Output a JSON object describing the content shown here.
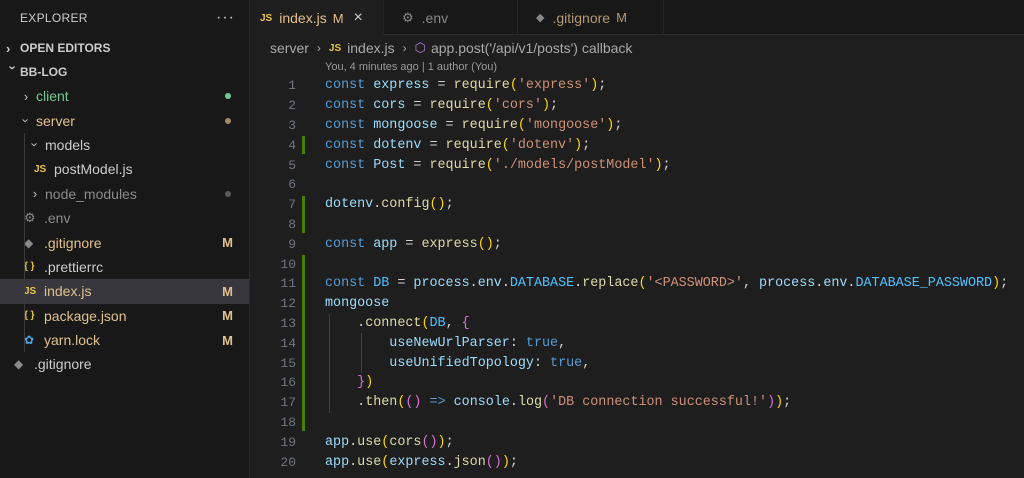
{
  "sidebar": {
    "title": "EXPLORER",
    "more_label": "···",
    "open_editors_label": "OPEN EDITORS",
    "project_label": "BB-LOG",
    "items": [
      {
        "label": "client",
        "color": "#73c991"
      },
      {
        "label": "server",
        "color": "#e2c08d"
      },
      {
        "label": "models",
        "color": "#cccccc"
      },
      {
        "label": "postModel.js",
        "icon": "JS",
        "color": "#cccccc"
      },
      {
        "label": "node_modules",
        "color": "#8b8b8b"
      },
      {
        "label": ".env",
        "color": "#8b8b8b"
      },
      {
        "label": ".gitignore",
        "color": "#e2c08d",
        "decoration": "M"
      },
      {
        "label": ".prettierrc",
        "icon": "{ }",
        "color": "#cccccc"
      },
      {
        "label": "index.js",
        "icon": "JS",
        "color": "#e2c08d",
        "decoration": "M"
      },
      {
        "label": "package.json",
        "icon": "{ }",
        "color": "#e2c08d",
        "decoration": "M"
      },
      {
        "label": "yarn.lock",
        "color": "#e2c08d",
        "decoration": "M"
      },
      {
        "label": ".gitignore",
        "color": "#cccccc"
      }
    ]
  },
  "tabs": [
    {
      "icon": "JS",
      "label": "index.js",
      "modified": "M",
      "close": "×",
      "active": true
    },
    {
      "label": ".env",
      "active": false
    },
    {
      "label": ".gitignore",
      "modified": "M",
      "active": false
    }
  ],
  "breadcrumb": {
    "folder": "server",
    "file_icon": "JS",
    "file": "index.js",
    "symbol": "app.post('/api/v1/posts') callback"
  },
  "editor": {
    "blame": "You, 4 minutes ago | 1 author (You)",
    "line_numbers": [
      "1",
      "2",
      "3",
      "4",
      "5",
      "6",
      "7",
      "8",
      "9",
      "10",
      "11",
      "12",
      "13",
      "14",
      "15",
      "16",
      "17",
      "18",
      "19",
      "20"
    ],
    "lines": [
      [
        [
          "kw",
          "const "
        ],
        [
          "var",
          "express"
        ],
        [
          "plain",
          " = "
        ],
        [
          "fn",
          "require"
        ],
        [
          "p1",
          "("
        ],
        [
          "str",
          "'express'"
        ],
        [
          "p1",
          ")"
        ],
        [
          "plain",
          ";"
        ]
      ],
      [
        [
          "kw",
          "const "
        ],
        [
          "var",
          "cors"
        ],
        [
          "plain",
          " = "
        ],
        [
          "fn",
          "require"
        ],
        [
          "p1",
          "("
        ],
        [
          "str",
          "'cors'"
        ],
        [
          "p1",
          ")"
        ],
        [
          "plain",
          ";"
        ]
      ],
      [
        [
          "kw",
          "const "
        ],
        [
          "var",
          "mongoose"
        ],
        [
          "plain",
          " = "
        ],
        [
          "fn",
          "require"
        ],
        [
          "p1",
          "("
        ],
        [
          "str",
          "'mongoose'"
        ],
        [
          "p1",
          ")"
        ],
        [
          "plain",
          ";"
        ]
      ],
      [
        [
          "kw",
          "const "
        ],
        [
          "var",
          "dotenv"
        ],
        [
          "plain",
          " = "
        ],
        [
          "fn",
          "require"
        ],
        [
          "p1",
          "("
        ],
        [
          "str",
          "'dotenv'"
        ],
        [
          "p1",
          ")"
        ],
        [
          "plain",
          ";"
        ]
      ],
      [
        [
          "kw",
          "const "
        ],
        [
          "var",
          "Post"
        ],
        [
          "plain",
          " = "
        ],
        [
          "fn",
          "require"
        ],
        [
          "p1",
          "("
        ],
        [
          "str",
          "'./models/postModel'"
        ],
        [
          "p1",
          ")"
        ],
        [
          "plain",
          ";"
        ]
      ],
      [],
      [
        [
          "var",
          "dotenv"
        ],
        [
          "plain",
          "."
        ],
        [
          "fn",
          "config"
        ],
        [
          "p1",
          "()"
        ],
        [
          "plain",
          ";"
        ]
      ],
      [],
      [
        [
          "kw",
          "const "
        ],
        [
          "var",
          "app"
        ],
        [
          "plain",
          " = "
        ],
        [
          "fn",
          "express"
        ],
        [
          "p1",
          "()"
        ],
        [
          "plain",
          ";"
        ]
      ],
      [],
      [
        [
          "kw",
          "const "
        ],
        [
          "const",
          "DB"
        ],
        [
          "plain",
          " = "
        ],
        [
          "var",
          "process"
        ],
        [
          "plain",
          "."
        ],
        [
          "var",
          "env"
        ],
        [
          "plain",
          "."
        ],
        [
          "const",
          "DATABASE"
        ],
        [
          "plain",
          "."
        ],
        [
          "fn",
          "replace"
        ],
        [
          "p1",
          "("
        ],
        [
          "str",
          "'<PASSWORD>'"
        ],
        [
          "plain",
          ", "
        ],
        [
          "var",
          "process"
        ],
        [
          "plain",
          "."
        ],
        [
          "var",
          "env"
        ],
        [
          "plain",
          "."
        ],
        [
          "const",
          "DATABASE_PASSWORD"
        ],
        [
          "p1",
          ")"
        ],
        [
          "plain",
          ";"
        ]
      ],
      [
        [
          "var",
          "mongoose"
        ]
      ],
      [
        [
          "plain",
          "    ."
        ],
        [
          "fn",
          "connect"
        ],
        [
          "p1",
          "("
        ],
        [
          "const",
          "DB"
        ],
        [
          "plain",
          ", "
        ],
        [
          "p2",
          "{"
        ]
      ],
      [
        [
          "plain",
          "        "
        ],
        [
          "var",
          "useNewUrlParser"
        ],
        [
          "plain",
          ": "
        ],
        [
          "bool",
          "true"
        ],
        [
          "plain",
          ","
        ]
      ],
      [
        [
          "plain",
          "        "
        ],
        [
          "var",
          "useUnifiedTopology"
        ],
        [
          "plain",
          ": "
        ],
        [
          "bool",
          "true"
        ],
        [
          "plain",
          ","
        ]
      ],
      [
        [
          "plain",
          "    "
        ],
        [
          "p2",
          "}"
        ],
        [
          "p1",
          ")"
        ]
      ],
      [
        [
          "plain",
          "    ."
        ],
        [
          "fn",
          "then"
        ],
        [
          "p1",
          "("
        ],
        [
          "p2",
          "()"
        ],
        [
          "plain",
          " "
        ],
        [
          "kw",
          "=>"
        ],
        [
          "plain",
          " "
        ],
        [
          "var",
          "console"
        ],
        [
          "plain",
          "."
        ],
        [
          "fn",
          "log"
        ],
        [
          "p2",
          "("
        ],
        [
          "str",
          "'DB connection successful!'"
        ],
        [
          "p2",
          ")"
        ],
        [
          "p1",
          ")"
        ],
        [
          "plain",
          ";"
        ]
      ],
      [],
      [
        [
          "var",
          "app"
        ],
        [
          "plain",
          "."
        ],
        [
          "fn",
          "use"
        ],
        [
          "p1",
          "("
        ],
        [
          "fn",
          "cors"
        ],
        [
          "p2",
          "()"
        ],
        [
          "p1",
          ")"
        ],
        [
          "plain",
          ";"
        ]
      ],
      [
        [
          "var",
          "app"
        ],
        [
          "plain",
          "."
        ],
        [
          "fn",
          "use"
        ],
        [
          "p1",
          "("
        ],
        [
          "var",
          "express"
        ],
        [
          "plain",
          "."
        ],
        [
          "fn",
          "json"
        ],
        [
          "p2",
          "()"
        ],
        [
          "p1",
          ")"
        ],
        [
          "plain",
          ";"
        ]
      ]
    ]
  }
}
